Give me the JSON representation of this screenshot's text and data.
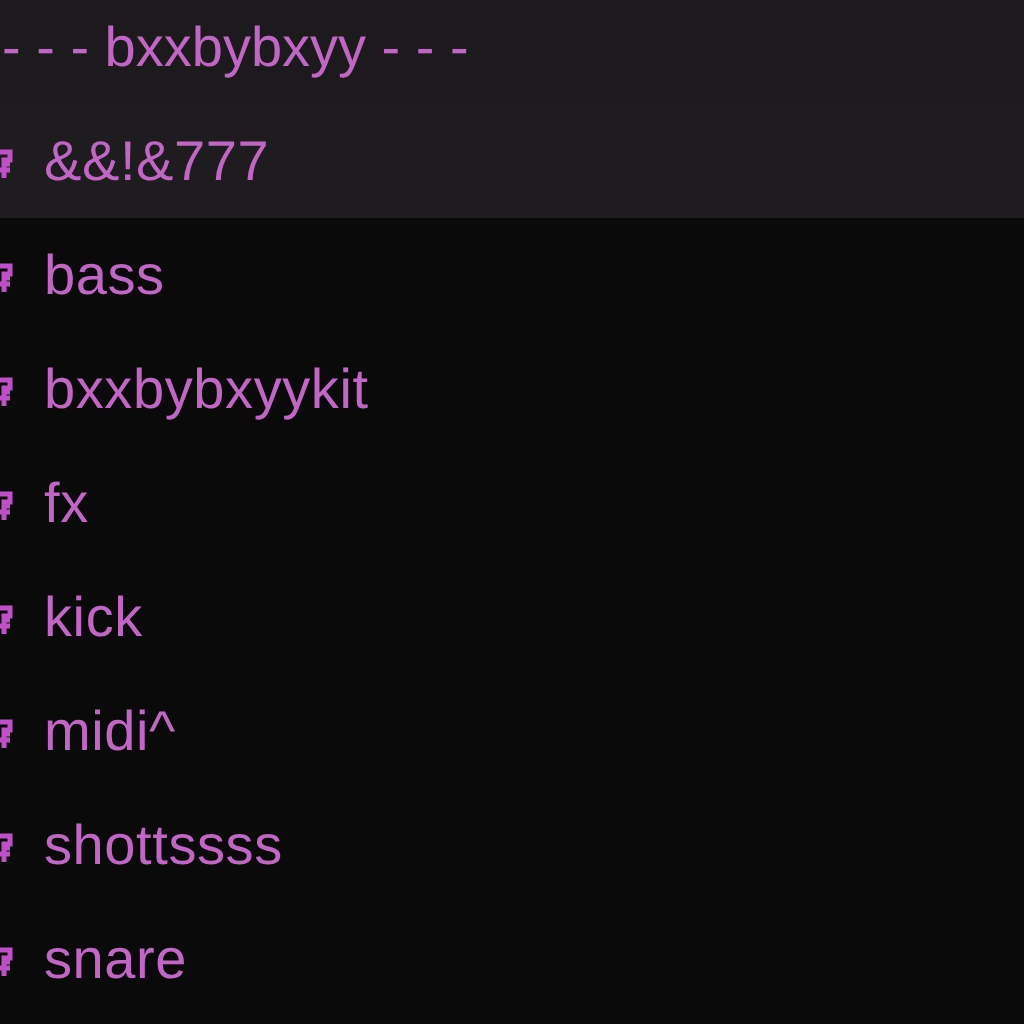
{
  "header": {
    "title": "- - - bxxbybxyy - - -"
  },
  "items": [
    {
      "label": "&&!&777",
      "selected": true
    },
    {
      "label": "bass",
      "selected": false
    },
    {
      "label": "bxxbybxyykit",
      "selected": false
    },
    {
      "label": "fx",
      "selected": false
    },
    {
      "label": "kick",
      "selected": false
    },
    {
      "label": "midi^",
      "selected": false
    },
    {
      "label": "shottssss",
      "selected": false
    },
    {
      "label": "snare",
      "selected": false
    }
  ]
}
